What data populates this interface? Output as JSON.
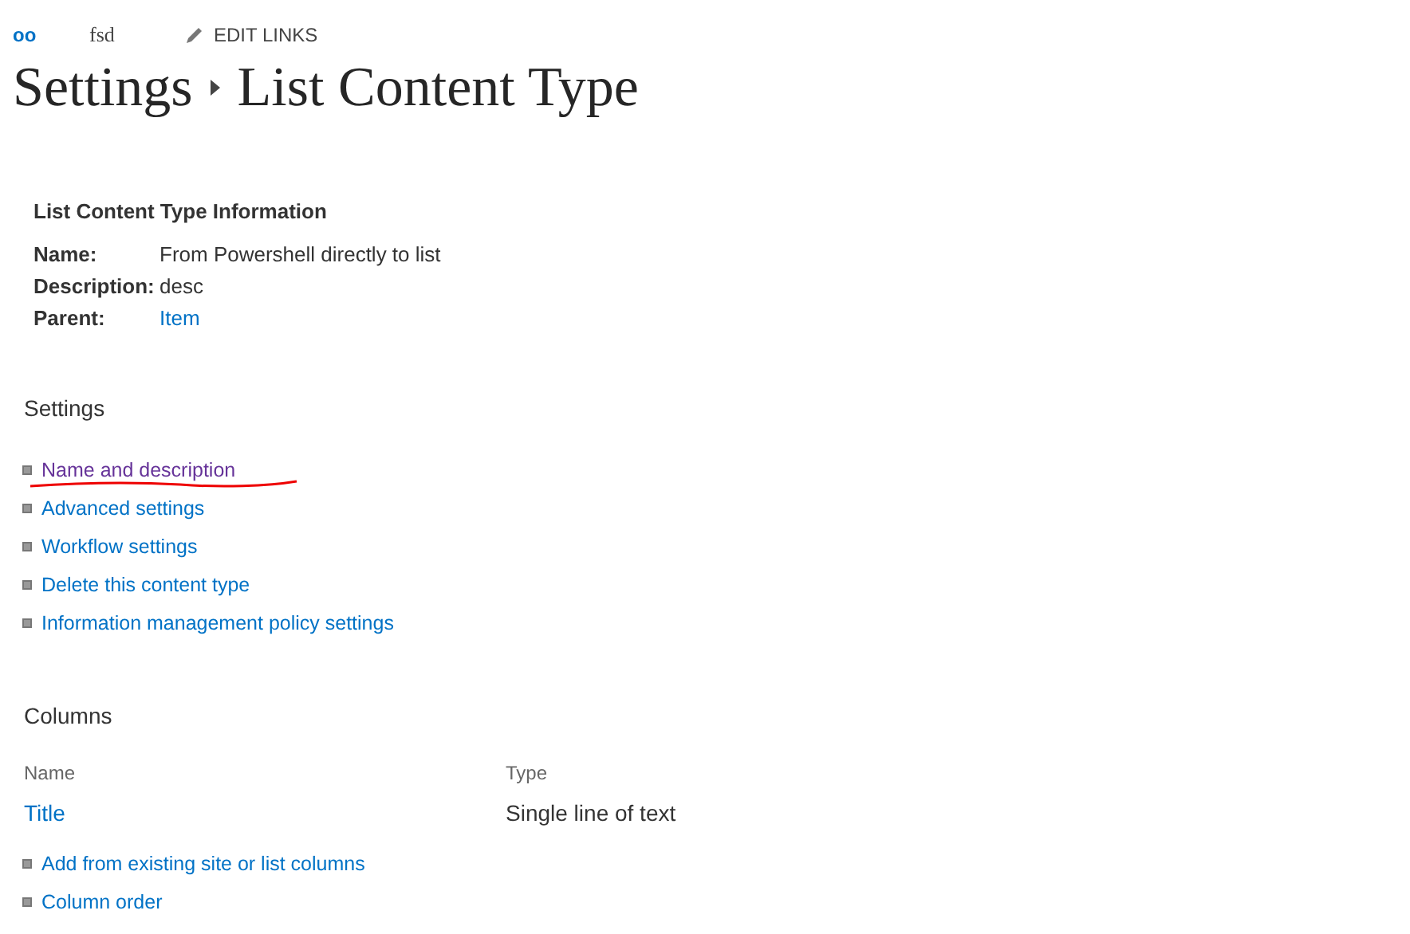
{
  "top_links": [
    {
      "text": "oo",
      "kind": "logo"
    },
    {
      "text": "fsd",
      "kind": "site"
    },
    {
      "text": "EDIT LINKS",
      "kind": "edit"
    }
  ],
  "breadcrumb": {
    "parent": "Settings",
    "current": "List Content Type"
  },
  "info": {
    "heading": "List Content Type Information",
    "fields": [
      {
        "label": "Name:",
        "value": "From Powershell directly to list",
        "link": false
      },
      {
        "label": "Description:",
        "value": "desc",
        "link": false
      },
      {
        "label": "Parent:",
        "value": "Item",
        "link": true
      }
    ]
  },
  "settings": {
    "heading": "Settings",
    "links": [
      {
        "text": "Name and description",
        "visited": true,
        "annotated": true
      },
      {
        "text": "Advanced settings",
        "visited": false,
        "annotated": false
      },
      {
        "text": "Workflow settings",
        "visited": false,
        "annotated": false
      },
      {
        "text": "Delete this content type",
        "visited": false,
        "annotated": false
      },
      {
        "text": "Information management policy settings",
        "visited": false,
        "annotated": false
      }
    ]
  },
  "columns": {
    "heading": "Columns",
    "table_columns": [
      "Name",
      "Type"
    ],
    "rows": [
      {
        "name": "Title",
        "type": "Single line of text"
      }
    ],
    "links": [
      {
        "text": "Add from existing site or list columns",
        "visited": false
      },
      {
        "text": "Column order",
        "visited": false
      }
    ]
  }
}
